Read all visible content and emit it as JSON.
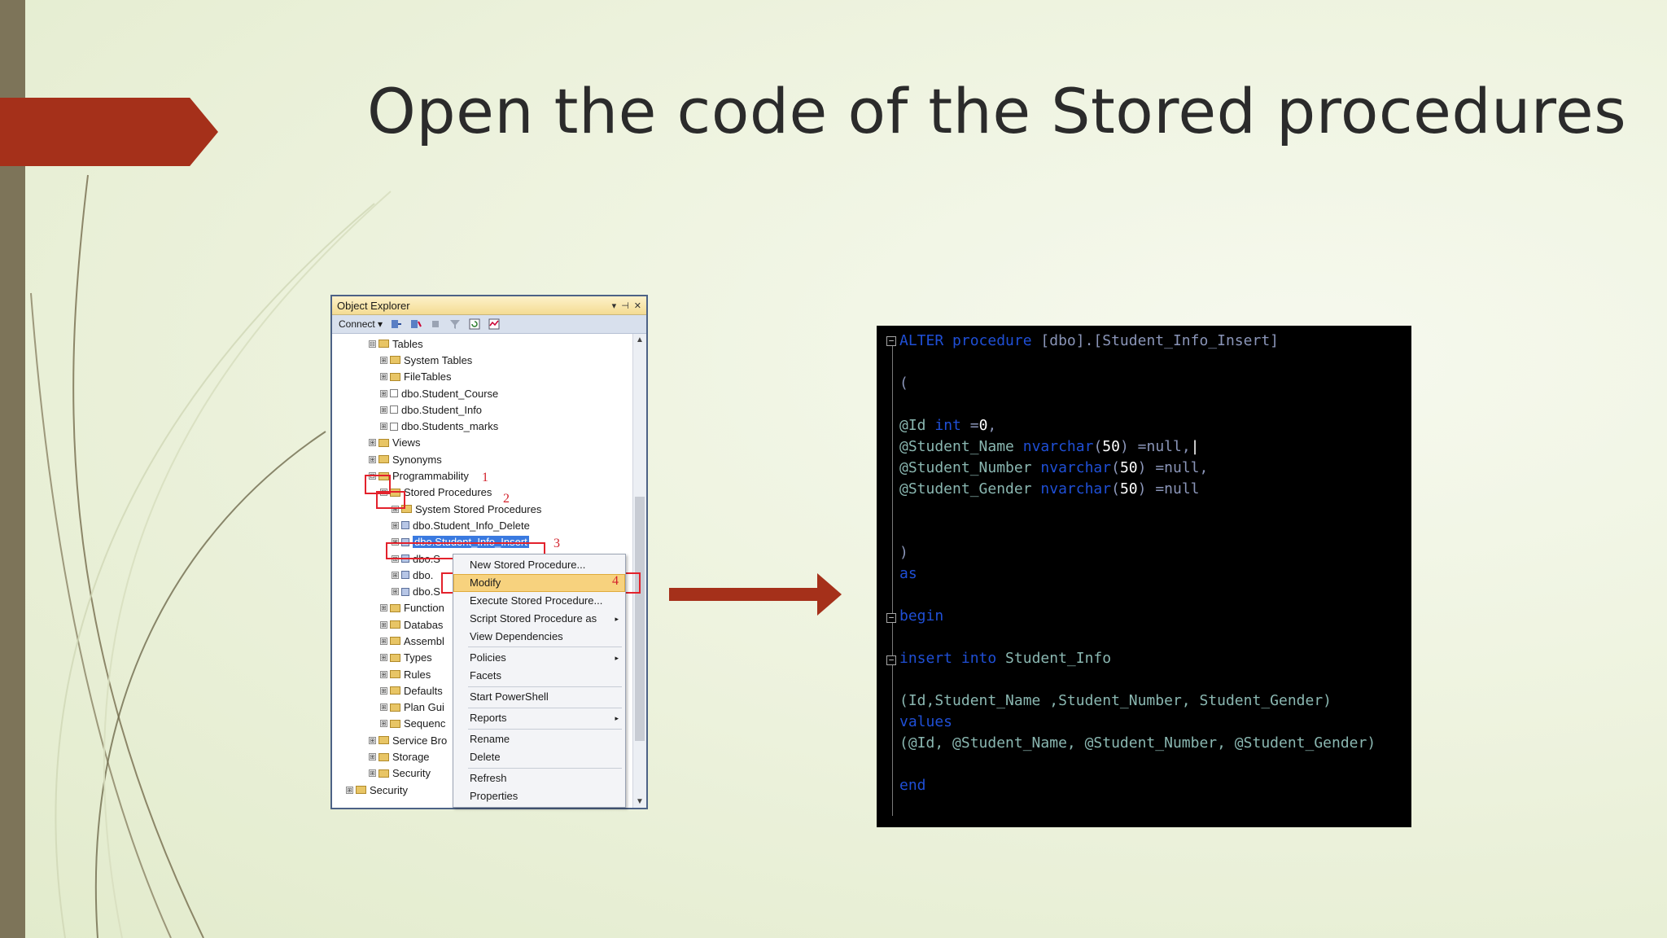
{
  "slide": {
    "title": "Open the code of the Stored procedures",
    "colors": {
      "accent": "#a5301a",
      "left_bar": "#7d7459",
      "background": "#eef3df"
    }
  },
  "object_explorer": {
    "title": "Object Explorer",
    "title_controls": [
      "▾",
      "⊣",
      "✕"
    ],
    "toolbar": {
      "connect_label": "Connect ▾"
    },
    "tree": [
      {
        "expander": "⊟",
        "label": "Tables"
      },
      {
        "expander": "⊞",
        "label": "System Tables"
      },
      {
        "expander": "⊞",
        "label": "FileTables"
      },
      {
        "expander": "⊞",
        "label": "dbo.Student_Course"
      },
      {
        "expander": "⊞",
        "label": "dbo.Student_Info"
      },
      {
        "expander": "⊞",
        "label": "dbo.Students_marks"
      },
      {
        "expander": "⊞",
        "label": "Views"
      },
      {
        "expander": "⊞",
        "label": "Synonyms"
      },
      {
        "expander": "⊟",
        "label": "Programmability"
      },
      {
        "expander": "⊟",
        "label": "Stored Procedures"
      },
      {
        "expander": "⊞",
        "label": "System Stored Procedures"
      },
      {
        "expander": "⊞",
        "label": "dbo.Student_Info_Delete"
      },
      {
        "expander": "⊞",
        "label": "dbo.Student_Info_Insert"
      },
      {
        "expander": "⊞",
        "label": "dbo.S"
      },
      {
        "expander": "⊞",
        "label": "dbo."
      },
      {
        "expander": "⊞",
        "label": "dbo.S"
      },
      {
        "expander": "⊞",
        "label": "Function"
      },
      {
        "expander": "⊞",
        "label": "Databas"
      },
      {
        "expander": "⊞",
        "label": "Assembl"
      },
      {
        "expander": "⊞",
        "label": "Types"
      },
      {
        "expander": "⊞",
        "label": "Rules"
      },
      {
        "expander": "⊞",
        "label": "Defaults"
      },
      {
        "expander": "⊞",
        "label": "Plan Gui"
      },
      {
        "expander": "⊞",
        "label": "Sequenc"
      },
      {
        "expander": "⊞",
        "label": "Service Bro"
      },
      {
        "expander": "⊞",
        "label": "Storage"
      },
      {
        "expander": "⊞",
        "label": "Security"
      },
      {
        "expander": "⊞",
        "label": "Security"
      }
    ],
    "step_numbers": [
      "1",
      "2",
      "3",
      "4"
    ]
  },
  "context_menu": {
    "items": [
      "New Stored Procedure...",
      "Modify",
      "Execute Stored Procedure...",
      "Script Stored Procedure as",
      "View Dependencies",
      "Policies",
      "Facets",
      "Start PowerShell",
      "Reports",
      "Rename",
      "Delete",
      "Refresh",
      "Properties"
    ],
    "submenu_arrow": "▸"
  },
  "code": {
    "fold_open": "−",
    "line1_kw": "ALTER procedure",
    "line1_name": " [dbo].[Student_Info_Insert]",
    "paren_open": "(",
    "id_param": "@Id",
    "id_type": " int",
    "id_default": " =",
    "id_value": "0",
    "id_tail": ",",
    "name_param": "@Student_Name",
    "name_type": " nvarchar",
    "name_len_open": "(",
    "name_len": "50",
    "name_tail": ") =null,",
    "cursor": "|",
    "number_param": "@Student_Number",
    "number_type": " nvarchar",
    "number_len_open": "(",
    "number_len": "50",
    "number_tail": ") =null,",
    "gender_param": "@Student_Gender",
    "gender_type": " nvarchar",
    "gender_len_open": "(",
    "gender_len": "50",
    "gender_tail": ") =null",
    "paren_close": ")",
    "as_kw": "as",
    "begin_kw": "begin",
    "insert_kw": "insert into",
    "insert_table": " Student_Info",
    "columns": "(Id,Student_Name ,Student_Number, Student_Gender)",
    "values_kw": "values",
    "values_list": "(@Id, @Student_Name, @Student_Number, @Student_Gender)",
    "end_kw": "end"
  }
}
